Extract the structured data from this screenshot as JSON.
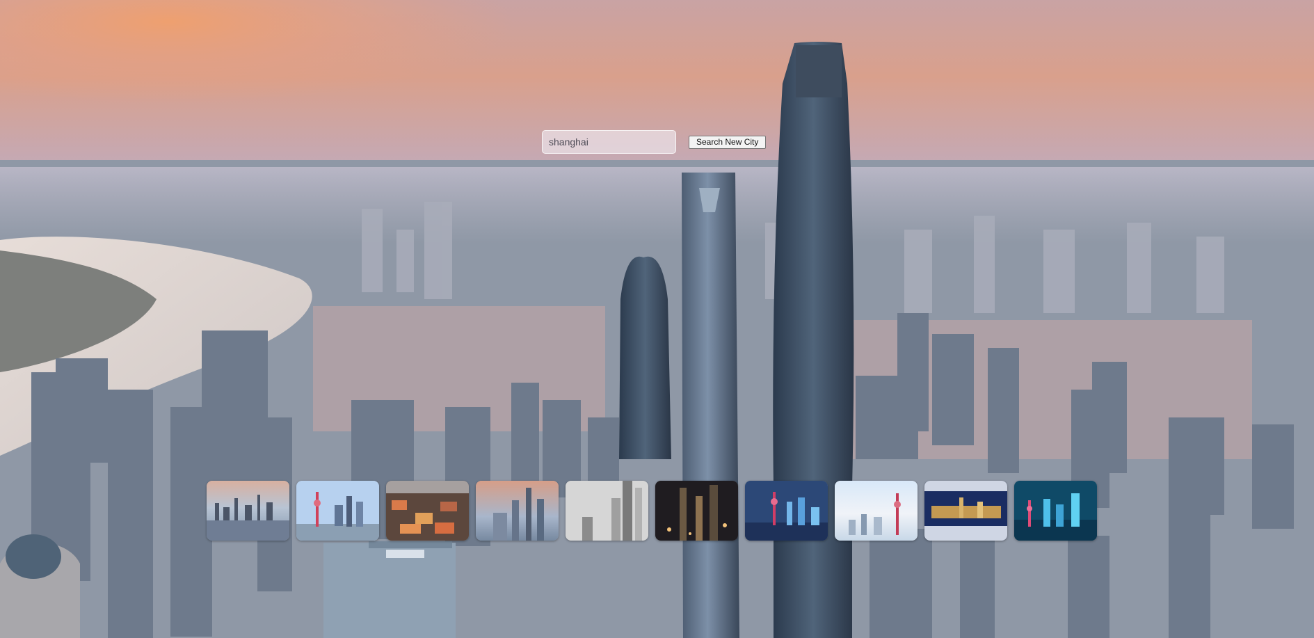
{
  "search": {
    "value": "shanghai",
    "button_label": "Search New City"
  },
  "gallery": {
    "images": [
      {
        "name": "shanghai-thumbnail-1",
        "theme": "sunset-reflection"
      },
      {
        "name": "shanghai-thumbnail-2",
        "theme": "blue-sky-tv-tower"
      },
      {
        "name": "shanghai-thumbnail-3",
        "theme": "aerial-city-lights"
      },
      {
        "name": "shanghai-thumbnail-4",
        "theme": "dusk-skyline"
      },
      {
        "name": "shanghai-thumbnail-5",
        "theme": "black-and-white-towers"
      },
      {
        "name": "shanghai-thumbnail-6",
        "theme": "night-towers"
      },
      {
        "name": "shanghai-thumbnail-7",
        "theme": "blue-night-reflection"
      },
      {
        "name": "shanghai-thumbnail-8",
        "theme": "pastel-sky-tower"
      },
      {
        "name": "shanghai-thumbnail-9",
        "theme": "panoramic-night"
      },
      {
        "name": "shanghai-thumbnail-10",
        "theme": "teal-night-skyline"
      }
    ]
  }
}
